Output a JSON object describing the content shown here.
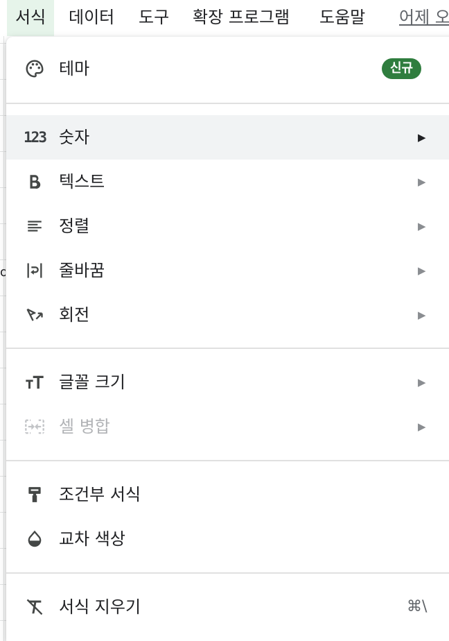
{
  "menubar": {
    "items": [
      "서식",
      "데이터",
      "도구",
      "확장 프로그램",
      "도움말"
    ],
    "last_edit": "어제 오"
  },
  "background": {
    "cell_fragment": "oa"
  },
  "menu": {
    "theme": {
      "label": "테마",
      "icon": "palette-icon",
      "badge": "신규",
      "badge_color": "#2f7d3e"
    },
    "number": {
      "label": "숫자",
      "icon": "number-format-icon",
      "icon_text": "123"
    },
    "text": {
      "label": "텍스트",
      "icon": "bold-icon"
    },
    "align": {
      "label": "정렬",
      "icon": "align-left-icon"
    },
    "wrap": {
      "label": "줄바꿈",
      "icon": "text-wrap-icon"
    },
    "rotate": {
      "label": "회전",
      "icon": "text-rotation-icon"
    },
    "font_size": {
      "label": "글꼴 크기",
      "icon": "font-size-icon"
    },
    "merge": {
      "label": "셀 병합",
      "icon": "merge-cells-icon",
      "disabled": true
    },
    "conditional": {
      "label": "조건부 서식",
      "icon": "paint-roller-icon"
    },
    "alternating": {
      "label": "교차 색상",
      "icon": "color-drop-icon"
    },
    "clear": {
      "label": "서식 지우기",
      "icon": "clear-formatting-icon",
      "shortcut": "⌘\\"
    }
  },
  "colors": {
    "active_menu_bg": "#e6f4ea",
    "hover_bg": "#f1f3f4",
    "accent_green": "#2f7d3e"
  }
}
